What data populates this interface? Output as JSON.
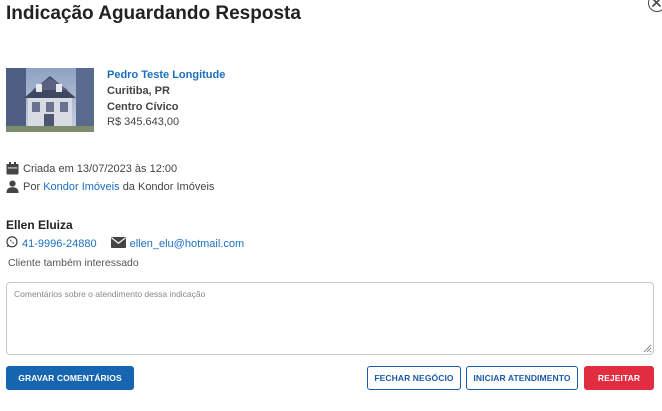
{
  "header": {
    "title": "Indicação Aguardando Resposta"
  },
  "property": {
    "name": "Pedro Teste Longitude",
    "city": "Curitiba, PR",
    "neighborhood": "Centro Cívico",
    "price": "R$ 345.643,00"
  },
  "meta": {
    "created": "Criada em 13/07/2023 às 12:00",
    "by_prefix": "Por",
    "by_agent": "Kondor Imóveis",
    "by_suffix": "da Kondor Imóveis"
  },
  "client": {
    "name": "Ellen Eluiza",
    "phone": "41-9996-24880",
    "email": "ellen_elu@hotmail.com",
    "note": "Cliente também interessado"
  },
  "comments": {
    "placeholder": "Comentários sobre o atendimento dessa indicação",
    "value": ""
  },
  "actions": {
    "save_label": "GRAVAR COMENTÁRIOS",
    "close_deal_label": "FECHAR NEGÓCIO",
    "start_label": "INICIAR ATENDIMENTO",
    "reject_label": "REJEITAR"
  },
  "colors": {
    "accent": "#1565b0",
    "link": "#1a6fc0",
    "danger": "#e12d3f"
  },
  "icons": {
    "close": "close-icon",
    "calendar": "calendar-icon",
    "user": "user-icon",
    "whatsapp": "whatsapp-icon",
    "email": "envelope-icon"
  }
}
